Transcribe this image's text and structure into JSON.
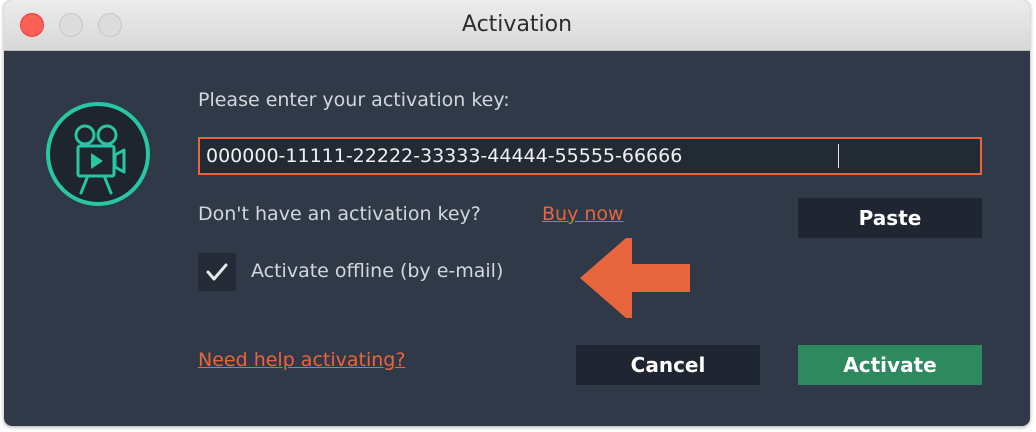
{
  "window": {
    "title": "Activation"
  },
  "form": {
    "prompt": "Please enter your activation key:",
    "key_value": "000000-11111-22222-33333-44444-55555-66666",
    "no_key_text": "Don't have an activation key?",
    "buy_link": "Buy now",
    "paste_label": "Paste",
    "offline_label": "Activate offline (by e-mail)",
    "offline_checked": true,
    "help_link": "Need help activating?",
    "cancel_label": "Cancel",
    "activate_label": "Activate"
  },
  "icons": {
    "logo": "movie-camera-icon",
    "check": "checkmark-icon",
    "pointer": "arrow-left-icon"
  },
  "colors": {
    "background": "#2f3947",
    "accent": "#e8663d",
    "logo": "#27c7a4",
    "activate": "#2e8a5e"
  }
}
